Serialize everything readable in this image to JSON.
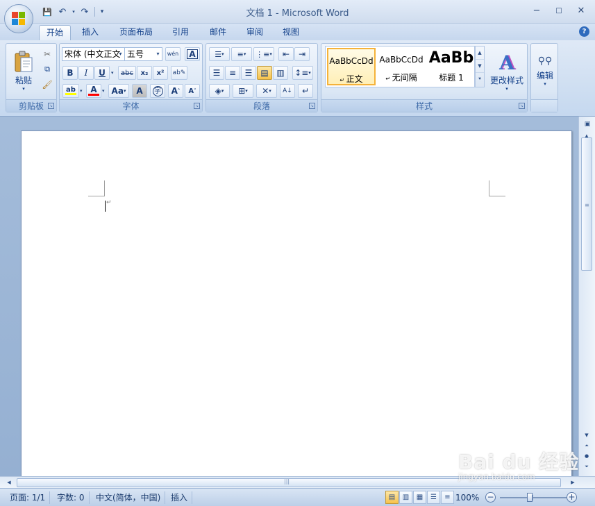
{
  "window": {
    "title": "文档 1 - Microsoft Word",
    "minimize": "−",
    "maximize": "□",
    "close": "✕"
  },
  "quick_access": {
    "save": "💾",
    "undo": "↶",
    "redo": "↷",
    "customize": "▾"
  },
  "tabs": [
    {
      "label": "开始"
    },
    {
      "label": "插入"
    },
    {
      "label": "页面布局"
    },
    {
      "label": "引用"
    },
    {
      "label": "邮件"
    },
    {
      "label": "审阅"
    },
    {
      "label": "视图"
    }
  ],
  "ribbon": {
    "clipboard": {
      "label": "剪贴板",
      "paste": "粘贴"
    },
    "font": {
      "label": "字体",
      "font_name": "宋体 (中文正文",
      "font_size": "五号",
      "bold": "B",
      "italic": "I",
      "underline": "U",
      "strike": "abc",
      "subscript": "x₂",
      "superscript": "x²",
      "highlight": "ab",
      "font_color": "A",
      "change_case": "Aa",
      "char_shading": "A",
      "enclose": "字",
      "grow": "A",
      "shrink": "A",
      "phonetic": "wén",
      "char_border": "A"
    },
    "paragraph": {
      "label": "段落"
    },
    "styles": {
      "label": "样式",
      "items": [
        {
          "sample": "AaBbCcDd",
          "name": "正文"
        },
        {
          "sample": "AaBbCcDd",
          "name": "无间隔"
        },
        {
          "sample": "AaBb",
          "name": "标题 1"
        }
      ],
      "change_styles": "更改样式"
    },
    "editing": {
      "label": "编辑"
    }
  },
  "status": {
    "page": "页面: 1/1",
    "words": "字数: 0",
    "language": "中文(简体，中国)",
    "mode": "插入",
    "zoom": "100%"
  },
  "watermark": {
    "brand": "Bai du 经验",
    "url": "jingyan.baidu.com"
  },
  "colors": {
    "highlight": "#ffff00",
    "font_color": "#ff0000",
    "selected_style_border": "#f5b23a"
  }
}
